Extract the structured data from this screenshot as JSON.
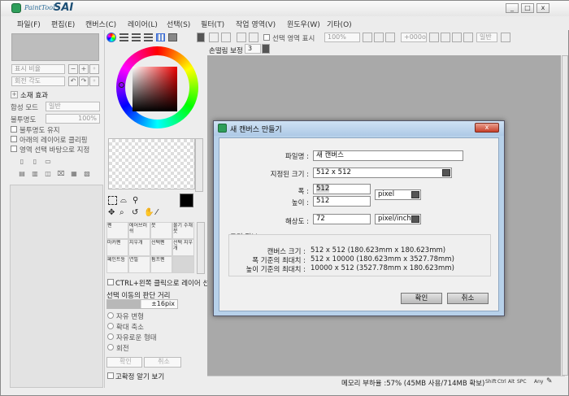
{
  "app": {
    "logo_small": "PaintTool",
    "logo_big": "SAI",
    "window_buttons": [
      "_",
      "□",
      "x"
    ]
  },
  "menu": [
    "파일(F)",
    "편집(E)",
    "캔버스(C)",
    "레이어(L)",
    "선택(S)",
    "필터(T)",
    "작업 영역(V)",
    "윈도우(W)",
    "기타(O)"
  ],
  "left": {
    "nav_labels": [
      "표시 비율",
      "회전 각도"
    ],
    "texture_title": "소재 효과",
    "blend_mode_label": "합성 모드",
    "blend_mode_value": "일반",
    "opacity_label": "불투명도",
    "opacity_value": "100%",
    "checks": [
      "불투명도 유지",
      "아래의 레이어로 클리핑",
      "영역 선택 바탕으로 지정"
    ]
  },
  "color": {
    "ctrl_pick_label": "CTRL+왼쪽 클릭으로 레이어 선",
    "select_move_label": "선택 이동의 판단 거리",
    "move_distance": "±16pix",
    "transform_options": [
      "자유 변형",
      "확대 축소",
      "자유로운 형태",
      "회전"
    ],
    "ok": "확인",
    "cancel": "취소",
    "bottom_check": "고확정 알기 보기"
  },
  "tools": [
    {
      "name": "펜"
    },
    {
      "name": "에어브러쉬"
    },
    {
      "name": "붓"
    },
    {
      "name": "물기 수채붓"
    },
    {
      "name": "마커펜"
    },
    {
      "name": "지우개"
    },
    {
      "name": "선택펜"
    },
    {
      "name": "선택 지우개"
    },
    {
      "name": "페인트통"
    },
    {
      "name": "연필"
    },
    {
      "name": "펌프펜"
    },
    {
      "name": ""
    }
  ],
  "toolbar": {
    "selection_show": "선택 영역 표시",
    "zoom": "100%",
    "angle": "+000o",
    "mode": "일반",
    "stabilizer_label": "손떨림 보정",
    "stabilizer_value": "3"
  },
  "status": {
    "memory": "메모리 부하율 :57% (45MB 사용/714MB 확보)",
    "keys": [
      "Shift",
      "Ctrl",
      "Alt",
      "SPC",
      "Any"
    ]
  },
  "dialog": {
    "title": "새 캔버스 만들기",
    "filename_label": "파일명 :",
    "filename_value": "새 캔버스",
    "preset_label": "지정된 크기 :",
    "preset_value": "512 x  512",
    "width_label": "폭 :",
    "width_value": "512",
    "height_label": "높이 :",
    "height_value": "512",
    "unit_value": "pixel",
    "resolution_label": "해상도 :",
    "resolution_value": "72",
    "res_unit_value": "pixel/inch",
    "size_info_title": "크기 정보",
    "info_rows": [
      {
        "label": "캔버스 크기 :",
        "value": "512 x 512 (180.623mm x 180.623mm)"
      },
      {
        "label": "폭 기준의 최대치 :",
        "value": "512 x 10000 (180.623mm x 3527.78mm)"
      },
      {
        "label": "높이 기준의 최대치 :",
        "value": "10000 x 512 (3527.78mm x 180.623mm)"
      }
    ],
    "ok": "확인",
    "cancel": "취소"
  }
}
